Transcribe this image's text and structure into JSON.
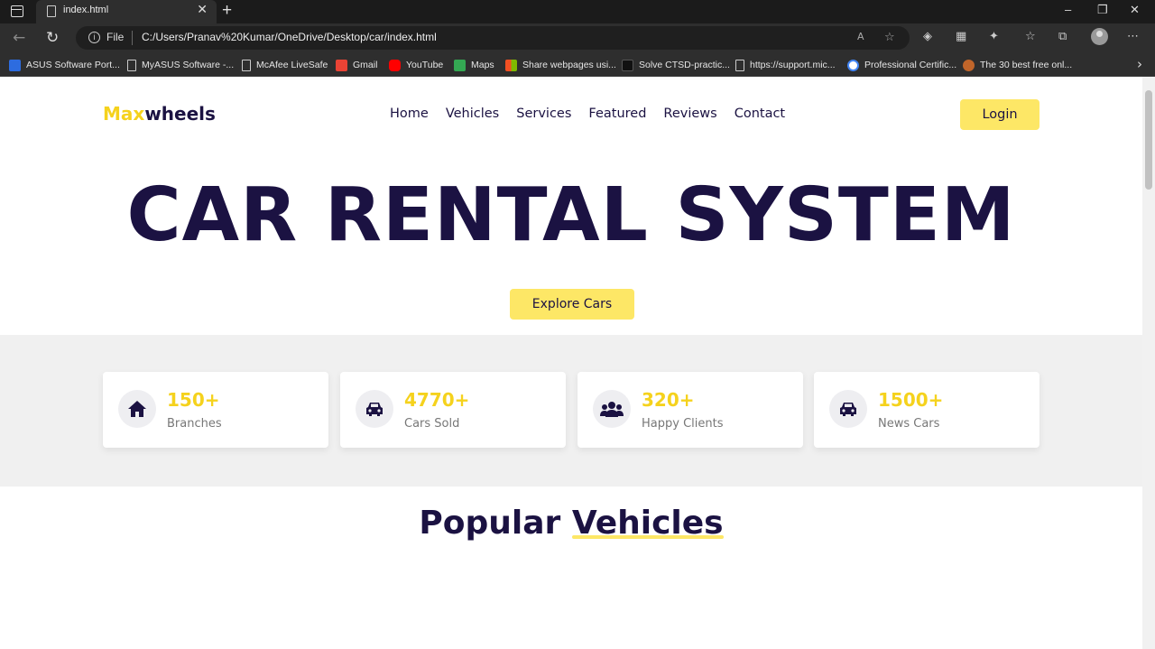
{
  "browser": {
    "tab_title": "index.html",
    "tab_close": "✕",
    "new_tab": "+",
    "address_scheme": "File",
    "address_url": "C:/Users/Pranav%20Kumar/OneDrive/Desktop/car/index.html",
    "window_controls": [
      "–",
      "❐",
      "✕"
    ],
    "bookmarks": [
      {
        "label": "ASUS Software Port...",
        "icon": "asus-icon",
        "color": "#2d6cdf"
      },
      {
        "label": "MyASUS Software -...",
        "icon": "page-icon"
      },
      {
        "label": "McAfee LiveSafe",
        "icon": "page-icon"
      },
      {
        "label": "Gmail",
        "icon": "gmail-icon",
        "color": "#ea4335"
      },
      {
        "label": "YouTube",
        "icon": "youtube-icon",
        "color": "#ff0000"
      },
      {
        "label": "Maps",
        "icon": "maps-icon",
        "color": "#34a853"
      },
      {
        "label": "Share webpages usi...",
        "icon": "microsoft-icon",
        "color": "#f25022"
      },
      {
        "label": "Solve CTSD-practic...",
        "icon": "hackerrank-icon",
        "color": "#111111"
      },
      {
        "label": "https://support.mic...",
        "icon": "page-icon"
      },
      {
        "label": "Professional Certific...",
        "icon": "google-icon",
        "color": "#4285f4"
      },
      {
        "label": "The 30 best free onl...",
        "icon": "site-icon",
        "color": "#c0652a"
      }
    ]
  },
  "site": {
    "brand_part1": "Max",
    "brand_part2": "wheels",
    "nav": [
      "Home",
      "Vehicles",
      "Services",
      "Featured",
      "Reviews",
      "Contact"
    ],
    "login_label": "Login",
    "hero_title": "CAR RENTAL SYSTEM",
    "hero_button": "Explore Cars",
    "stats": [
      {
        "value": "150+",
        "label": "Branches",
        "icon": "home-icon"
      },
      {
        "value": "4770+",
        "label": "Cars Sold",
        "icon": "car-icon"
      },
      {
        "value": "320+",
        "label": "Happy Clients",
        "icon": "users-icon"
      },
      {
        "value": "1500+",
        "label": "News Cars",
        "icon": "car-icon"
      }
    ],
    "section_title_part1": "Popular",
    "section_title_part2": "Vehicles"
  },
  "colors": {
    "accent": "#fde766",
    "accent_text": "#f5d21d",
    "navy": "#1b1242"
  }
}
